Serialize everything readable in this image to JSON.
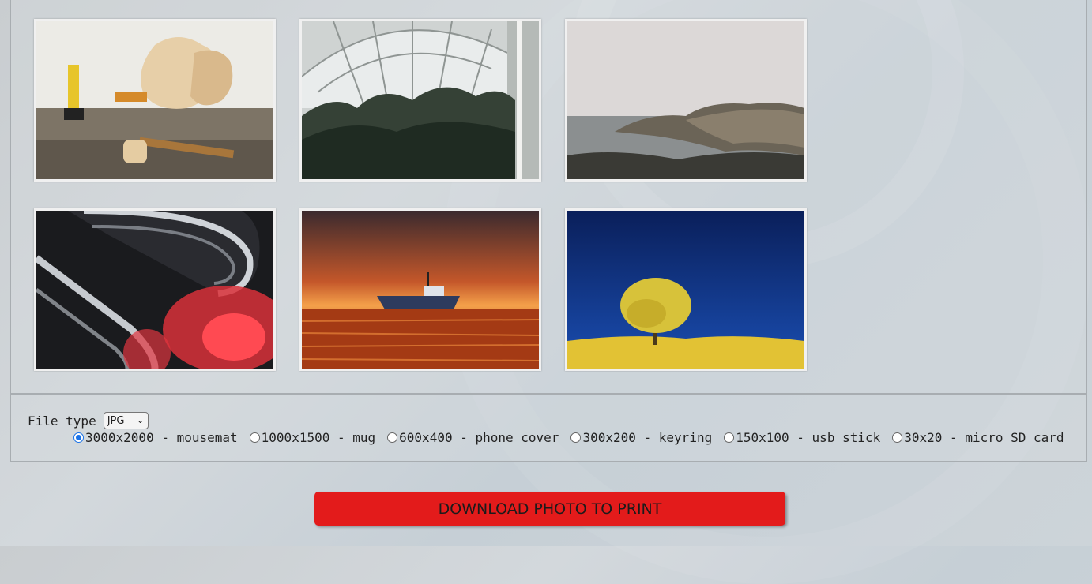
{
  "gallery": {
    "photos": [
      {
        "name": "workshop-guitar-photo"
      },
      {
        "name": "greenhouse-palms-photo"
      },
      {
        "name": "misty-coast-photo"
      },
      {
        "name": "chrome-red-abstract-photo"
      },
      {
        "name": "sunset-boat-photo"
      },
      {
        "name": "yellow-tree-blue-sky-photo"
      }
    ]
  },
  "options": {
    "file_type_label": "File type",
    "file_type_value": "JPG",
    "sizes": [
      {
        "label": "3000x2000 - mousemat",
        "checked": true
      },
      {
        "label": "1000x1500 - mug",
        "checked": false
      },
      {
        "label": "600x400 - phone cover",
        "checked": false
      },
      {
        "label": "300x200 - keyring",
        "checked": false
      },
      {
        "label": "150x100 - usb stick",
        "checked": false
      },
      {
        "label": "30x20 - micro SD card",
        "checked": false
      }
    ]
  },
  "download_label": "DOWNLOAD PHOTO TO PRINT",
  "colors": {
    "accent": "#e31b1b",
    "radio_selected": "#1a73e8"
  }
}
